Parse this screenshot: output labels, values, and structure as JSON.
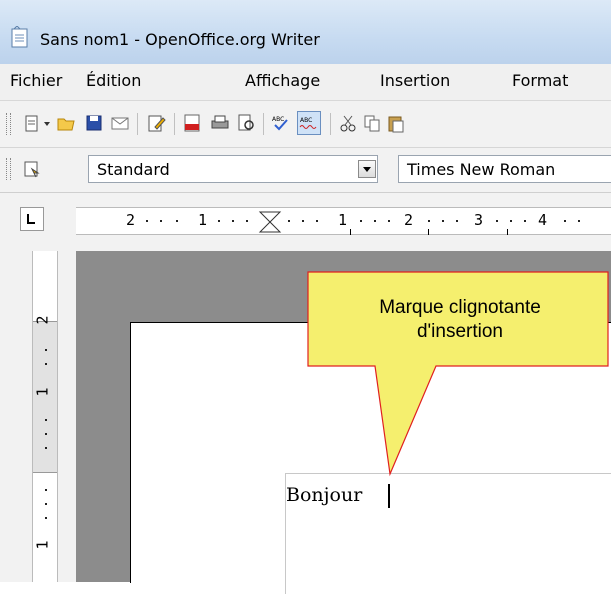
{
  "window": {
    "title": "Sans nom1 - OpenOffice.org Writer",
    "icon": "writer-document-icon"
  },
  "menubar": {
    "items": [
      "Fichier",
      "Édition",
      "Affichage",
      "Insertion",
      "Format"
    ]
  },
  "toolbar": {
    "icons": [
      "new-document-icon",
      "dropdown-arrow-icon",
      "open-folder-icon",
      "save-icon",
      "email-icon",
      "edit-document-icon",
      "export-pdf-icon",
      "print-icon",
      "print-preview-icon",
      "spellcheck-icon",
      "autospellcheck-icon",
      "cut-icon",
      "copy-icon",
      "paste-icon"
    ]
  },
  "formatting": {
    "styles_icon": "styles-formatting-icon",
    "paragraph_style": "Standard",
    "font_name": "Times New Roman"
  },
  "ruler": {
    "labels": [
      "2",
      "1",
      "1",
      "2",
      "3",
      "4"
    ],
    "vertical_labels": [
      "2",
      "1",
      "1"
    ]
  },
  "document": {
    "text": "Bonjour"
  },
  "callout": {
    "line1": "Marque clignotante",
    "line2": "d'insertion",
    "fill": "#f5ef6e",
    "border": "#e02020"
  }
}
